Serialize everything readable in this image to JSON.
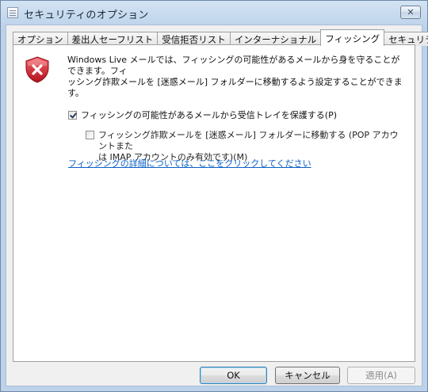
{
  "window": {
    "title": "セキュリティのオプション",
    "close_label": "✕"
  },
  "tabs": [
    {
      "label": "オプション",
      "active": false
    },
    {
      "label": "差出人セーフリスト",
      "active": false
    },
    {
      "label": "受信拒否リスト",
      "active": false
    },
    {
      "label": "インターナショナル",
      "active": false
    },
    {
      "label": "フィッシング",
      "active": true
    },
    {
      "label": "セキュリティ",
      "active": false
    }
  ],
  "phishing": {
    "description_line1": "Windows Live メールでは、フィッシングの可能性があるメールから身を守ることができます。フィ",
    "description_line2": "ッシング詐欺メールを [迷惑メール] フォルダーに移動するよう設定することができます。",
    "protect_label": "フィッシングの可能性があるメールから受信トレイを保護する(P)",
    "protect_checked": true,
    "move_label_line1": "フィッシング詐欺メールを [迷惑メール] フォルダーに移動する (POP アカウントまた",
    "move_label_line2": "は IMAP アカウントのみ有効です)(M)",
    "move_checked": false,
    "link_text": "フィッシングの詳細については、ここをクリックしてください"
  },
  "buttons": {
    "ok": "OK",
    "cancel": "キャンセル",
    "apply": "適用(A)"
  },
  "colors": {
    "shield_red": "#d9232e",
    "link": "#0b5fc5"
  },
  "icons": {
    "shield": "security-shield-x-icon",
    "window": "window-app-icon"
  }
}
